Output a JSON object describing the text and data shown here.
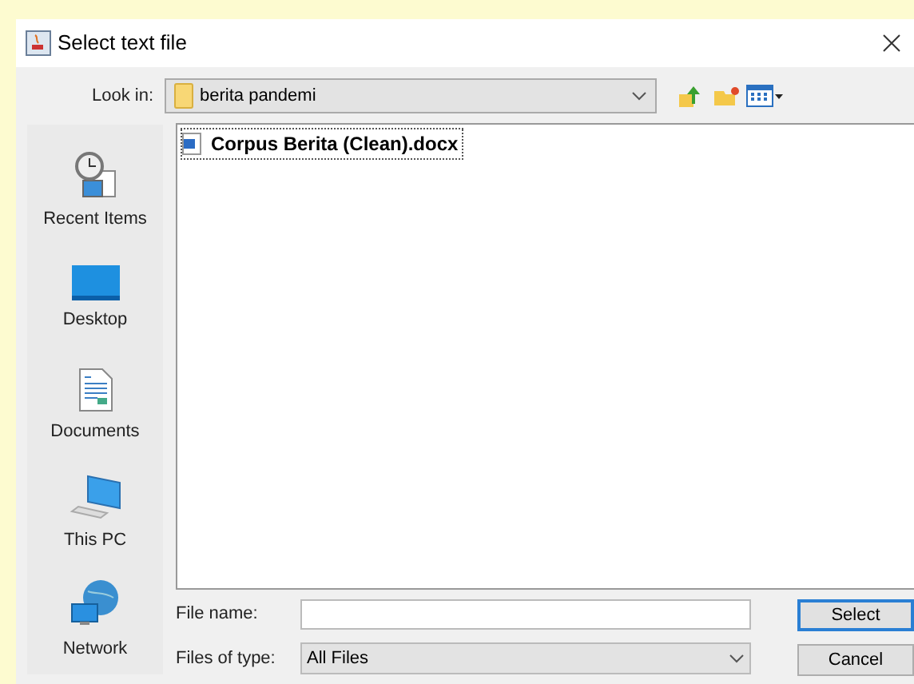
{
  "window": {
    "title": "Select text file"
  },
  "look_in": {
    "label": "Look in:",
    "value": "berita pandemi"
  },
  "places": [
    {
      "kind": "recent",
      "label": "Recent Items"
    },
    {
      "kind": "desktop",
      "label": "Desktop"
    },
    {
      "kind": "documents",
      "label": "Documents"
    },
    {
      "kind": "pc",
      "label": "This PC"
    },
    {
      "kind": "network",
      "label": "Network"
    }
  ],
  "files": [
    {
      "name": "Corpus Berita (Clean).docx",
      "focused": true
    }
  ],
  "file_name": {
    "label": "File name:"
  },
  "files_of_type": {
    "label": "Files of type:",
    "value": "All Files"
  },
  "buttons": [
    {
      "label": "Select",
      "default": true
    },
    {
      "label": "Cancel",
      "default": false
    }
  ]
}
